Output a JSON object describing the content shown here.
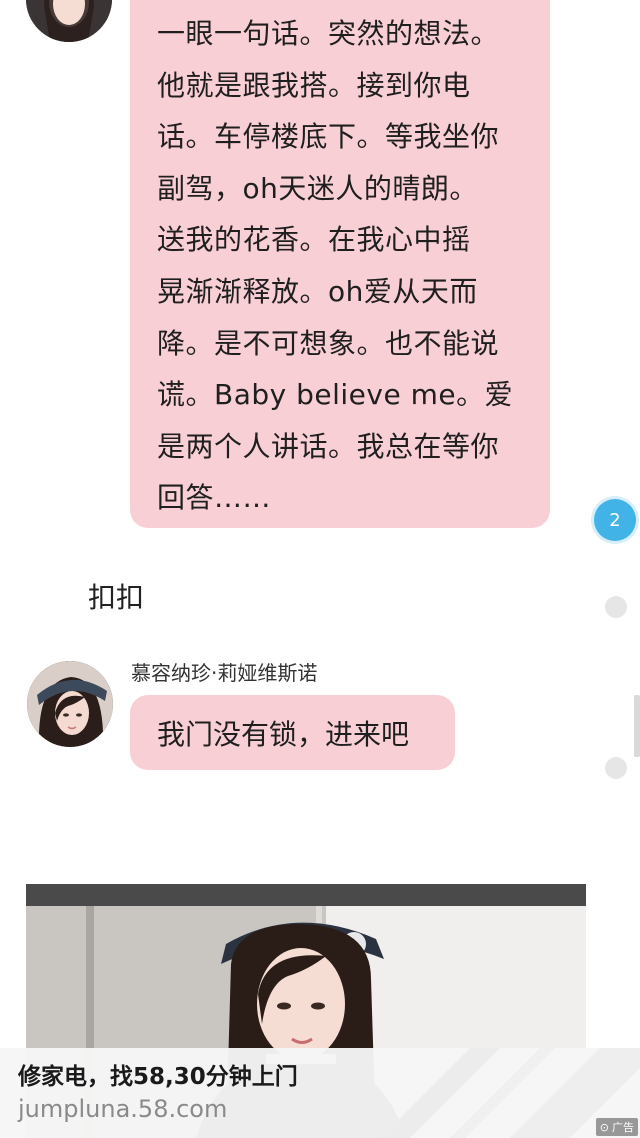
{
  "messages": {
    "lyric_bubble": {
      "lines": [
        "一眼一句话。突然的想法。",
        "他就是跟我搭。接到你电",
        "话。车停楼底下。等我坐你",
        "副驾，oh天迷人的晴朗。",
        "送我的花香。在我心中摇",
        "晃渐渐释放。oh爱从天而",
        "降。是不可想象。也不能说",
        "谎。Baby believe me。爱",
        "是两个人讲话。我总在等你",
        "回答……"
      ]
    },
    "unread_badge": "2",
    "plain_message": "扣扣",
    "sender_name": "慕容纳珍·莉娅维斯诺",
    "reply_bubble": "我门没有锁，进来吧"
  },
  "ad": {
    "title": "修家电，找58,30分钟上门",
    "url": "jumpluna.58.com",
    "tag": "广告"
  },
  "colors": {
    "bubble": "#f9cfd6",
    "badge": "#41b3e6",
    "ad_background": "#f6f6f6"
  }
}
